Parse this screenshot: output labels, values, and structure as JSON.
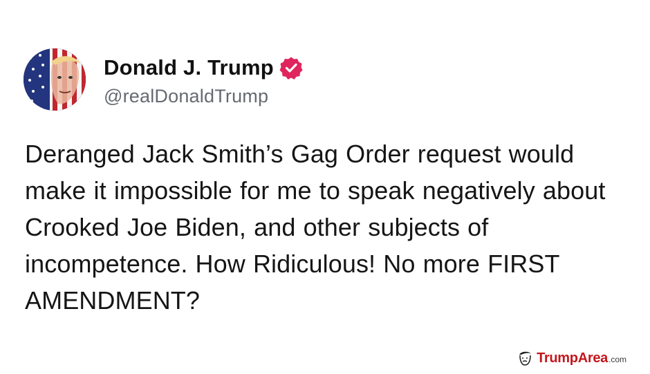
{
  "post": {
    "author": {
      "display_name": "Donald J. Trump",
      "handle": "@realDonaldTrump",
      "verified": true,
      "avatar_icon": "flag-portrait-avatar",
      "verified_icon": "verified-badge-icon"
    },
    "text": "Deranged Jack Smith’s Gag Order request would make it impossible for me to speak negatively about Crooked Joe Biden, and other subjects of incompetence. How Ridiculous! No more FIRST AMENDMENT?"
  },
  "watermark": {
    "brand": "TrumpArea",
    "tld": ".com",
    "icon": "trump-face-logo-icon"
  },
  "colors": {
    "background": "#ffffff",
    "text": "#151515",
    "handle": "#666a70",
    "verified_badge": "#e0245e",
    "watermark_brand": "#c4161c"
  }
}
